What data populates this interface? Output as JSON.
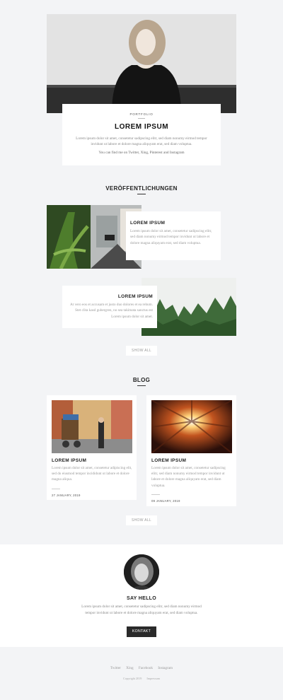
{
  "hero": {
    "kicker": "PORTFOLIO",
    "title": "LOREM IPSUM",
    "text": "Lorem ipsum dolor sit amet, consetetur sadipscing elitr, sed diam nonumy eirmod tempor invidunt ut labore et dolore magna aliquyam erat, sed diam voluptua.",
    "sub": "You can find me on Twitter, Xing, Pinterest and Instagram"
  },
  "publications": {
    "heading": "VERÖFFENTLICHUNGEN",
    "items": [
      {
        "title": "LOREM IPSUM",
        "text": "Lorem ipsum dolor sit amet, consetetur sadipscing elitr, sed diam nonumy eirmod tempor invidunt ut labore et dolore magna aliquyam erat, sed diam voluptua."
      },
      {
        "title": "LOREM IPSUM",
        "text": "At vero eos et accusam et justo duo dolores et ea rebum. Stet clita kasd gubergren, no sea takimata sanctus est Lorem ipsum dolor sit amet."
      }
    ],
    "show_all": "SHOW ALL"
  },
  "blog": {
    "heading": "BLOG",
    "posts": [
      {
        "title": "LOREM IPSUM",
        "text": "Lorem ipsum dolor sit amet, consetetur adipiscing elit, sed do eiusmod tempor incididunt ut labore et dolore magna aliqua.",
        "date": "27 JANUARY, 2019"
      },
      {
        "title": "LOREM IPSUM",
        "text": "Lorem ipsum dolor sit amet, consetetur sadipscing elitr, sed diam nonumy eirmod tempor invidunt ut labore et dolore magna aliquyam erat, sed diam voluptua.",
        "date": "09 JANUARY, 2019"
      }
    ],
    "show_all": "SHOW ALL"
  },
  "hello": {
    "title": "SAY HELLO",
    "text": "Lorem ipsum dolor sit amet, consetetur sadipscing elitr, sed diam nonumy eirmod tempor invidunt ut labore et dolore magna aliquyam erat, sed diam voluptua.",
    "button": "KONTAKT"
  },
  "footer": {
    "links": [
      "Twitter",
      "Xing",
      "Facebook",
      "Instagram"
    ],
    "copyright": "Copyright 2019",
    "imprint": "Impressum"
  }
}
